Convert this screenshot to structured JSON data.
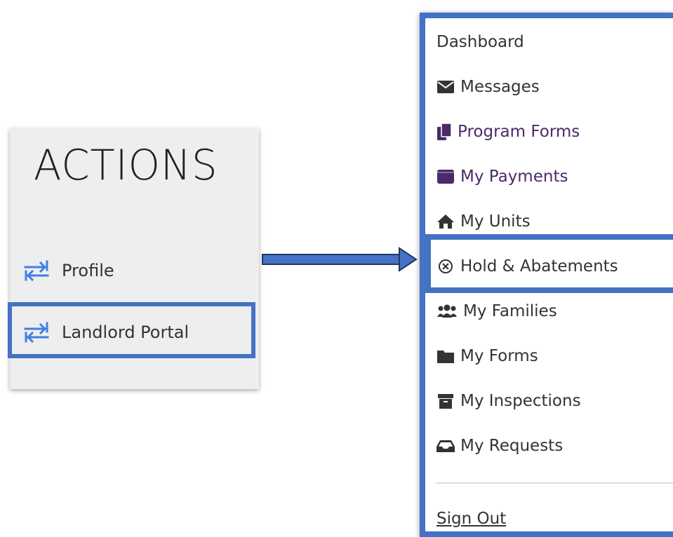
{
  "actions": {
    "title": "ACTIONS",
    "items": [
      {
        "label": "Profile",
        "icon": "swap-arrows-icon"
      },
      {
        "label": "Landlord Portal",
        "icon": "swap-arrows-icon"
      }
    ]
  },
  "menu": {
    "items": [
      {
        "label": "Dashboard",
        "icon": ""
      },
      {
        "label": "Messages",
        "icon": "envelope-icon"
      },
      {
        "label": "Program Forms",
        "icon": "copy-icon"
      },
      {
        "label": "My Payments",
        "icon": "wallet-icon"
      },
      {
        "label": "My Units",
        "icon": "home-icon"
      },
      {
        "label": "Hold & Abatements",
        "icon": "circle-x-icon"
      },
      {
        "label": "My Families",
        "icon": "users-icon"
      },
      {
        "label": "My Forms",
        "icon": "folder-icon"
      },
      {
        "label": "My Inspections",
        "icon": "archive-icon"
      },
      {
        "label": "My Requests",
        "icon": "inbox-icon"
      }
    ],
    "sign_out": "Sign Out"
  },
  "colors": {
    "highlight": "#4472c4",
    "icon_blue": "#3f7fe6",
    "purple": "#4a2a6a",
    "panel_bg": "#eeeeee"
  }
}
